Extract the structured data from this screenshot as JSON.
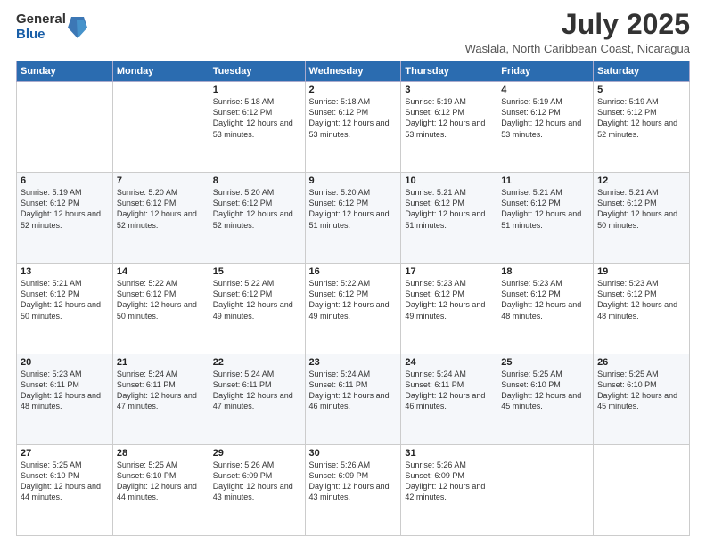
{
  "logo": {
    "general": "General",
    "blue": "Blue"
  },
  "title": {
    "month_year": "July 2025",
    "location": "Waslala, North Caribbean Coast, Nicaragua"
  },
  "days_of_week": [
    "Sunday",
    "Monday",
    "Tuesday",
    "Wednesday",
    "Thursday",
    "Friday",
    "Saturday"
  ],
  "weeks": [
    [
      {
        "day": "",
        "info": ""
      },
      {
        "day": "",
        "info": ""
      },
      {
        "day": "1",
        "info": "Sunrise: 5:18 AM\nSunset: 6:12 PM\nDaylight: 12 hours and 53 minutes."
      },
      {
        "day": "2",
        "info": "Sunrise: 5:18 AM\nSunset: 6:12 PM\nDaylight: 12 hours and 53 minutes."
      },
      {
        "day": "3",
        "info": "Sunrise: 5:19 AM\nSunset: 6:12 PM\nDaylight: 12 hours and 53 minutes."
      },
      {
        "day": "4",
        "info": "Sunrise: 5:19 AM\nSunset: 6:12 PM\nDaylight: 12 hours and 53 minutes."
      },
      {
        "day": "5",
        "info": "Sunrise: 5:19 AM\nSunset: 6:12 PM\nDaylight: 12 hours and 52 minutes."
      }
    ],
    [
      {
        "day": "6",
        "info": "Sunrise: 5:19 AM\nSunset: 6:12 PM\nDaylight: 12 hours and 52 minutes."
      },
      {
        "day": "7",
        "info": "Sunrise: 5:20 AM\nSunset: 6:12 PM\nDaylight: 12 hours and 52 minutes."
      },
      {
        "day": "8",
        "info": "Sunrise: 5:20 AM\nSunset: 6:12 PM\nDaylight: 12 hours and 52 minutes."
      },
      {
        "day": "9",
        "info": "Sunrise: 5:20 AM\nSunset: 6:12 PM\nDaylight: 12 hours and 51 minutes."
      },
      {
        "day": "10",
        "info": "Sunrise: 5:21 AM\nSunset: 6:12 PM\nDaylight: 12 hours and 51 minutes."
      },
      {
        "day": "11",
        "info": "Sunrise: 5:21 AM\nSunset: 6:12 PM\nDaylight: 12 hours and 51 minutes."
      },
      {
        "day": "12",
        "info": "Sunrise: 5:21 AM\nSunset: 6:12 PM\nDaylight: 12 hours and 50 minutes."
      }
    ],
    [
      {
        "day": "13",
        "info": "Sunrise: 5:21 AM\nSunset: 6:12 PM\nDaylight: 12 hours and 50 minutes."
      },
      {
        "day": "14",
        "info": "Sunrise: 5:22 AM\nSunset: 6:12 PM\nDaylight: 12 hours and 50 minutes."
      },
      {
        "day": "15",
        "info": "Sunrise: 5:22 AM\nSunset: 6:12 PM\nDaylight: 12 hours and 49 minutes."
      },
      {
        "day": "16",
        "info": "Sunrise: 5:22 AM\nSunset: 6:12 PM\nDaylight: 12 hours and 49 minutes."
      },
      {
        "day": "17",
        "info": "Sunrise: 5:23 AM\nSunset: 6:12 PM\nDaylight: 12 hours and 49 minutes."
      },
      {
        "day": "18",
        "info": "Sunrise: 5:23 AM\nSunset: 6:12 PM\nDaylight: 12 hours and 48 minutes."
      },
      {
        "day": "19",
        "info": "Sunrise: 5:23 AM\nSunset: 6:12 PM\nDaylight: 12 hours and 48 minutes."
      }
    ],
    [
      {
        "day": "20",
        "info": "Sunrise: 5:23 AM\nSunset: 6:11 PM\nDaylight: 12 hours and 48 minutes."
      },
      {
        "day": "21",
        "info": "Sunrise: 5:24 AM\nSunset: 6:11 PM\nDaylight: 12 hours and 47 minutes."
      },
      {
        "day": "22",
        "info": "Sunrise: 5:24 AM\nSunset: 6:11 PM\nDaylight: 12 hours and 47 minutes."
      },
      {
        "day": "23",
        "info": "Sunrise: 5:24 AM\nSunset: 6:11 PM\nDaylight: 12 hours and 46 minutes."
      },
      {
        "day": "24",
        "info": "Sunrise: 5:24 AM\nSunset: 6:11 PM\nDaylight: 12 hours and 46 minutes."
      },
      {
        "day": "25",
        "info": "Sunrise: 5:25 AM\nSunset: 6:10 PM\nDaylight: 12 hours and 45 minutes."
      },
      {
        "day": "26",
        "info": "Sunrise: 5:25 AM\nSunset: 6:10 PM\nDaylight: 12 hours and 45 minutes."
      }
    ],
    [
      {
        "day": "27",
        "info": "Sunrise: 5:25 AM\nSunset: 6:10 PM\nDaylight: 12 hours and 44 minutes."
      },
      {
        "day": "28",
        "info": "Sunrise: 5:25 AM\nSunset: 6:10 PM\nDaylight: 12 hours and 44 minutes."
      },
      {
        "day": "29",
        "info": "Sunrise: 5:26 AM\nSunset: 6:09 PM\nDaylight: 12 hours and 43 minutes."
      },
      {
        "day": "30",
        "info": "Sunrise: 5:26 AM\nSunset: 6:09 PM\nDaylight: 12 hours and 43 minutes."
      },
      {
        "day": "31",
        "info": "Sunrise: 5:26 AM\nSunset: 6:09 PM\nDaylight: 12 hours and 42 minutes."
      },
      {
        "day": "",
        "info": ""
      },
      {
        "day": "",
        "info": ""
      }
    ]
  ]
}
